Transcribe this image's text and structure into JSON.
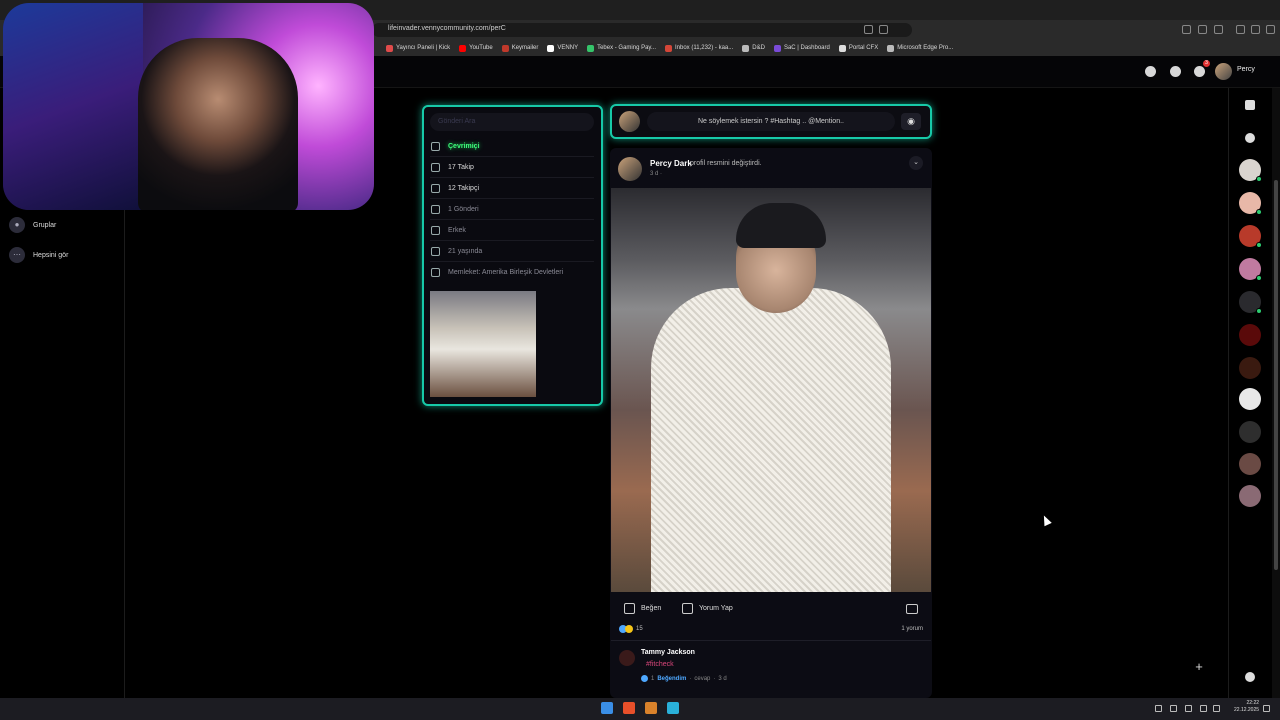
{
  "browser": {
    "url": "lifeinvader.vennycommunity.com/perC",
    "bookmarks": [
      {
        "label": "Yayıncı Paneli | Kick",
        "color": "#e04b4b"
      },
      {
        "label": "YouTube",
        "color": "#ff0000"
      },
      {
        "label": "Keymailer",
        "color": "#c0392b"
      },
      {
        "label": "VENNY",
        "color": "#ffffff"
      },
      {
        "label": "Tebex - Gaming Pay...",
        "color": "#35c46a"
      },
      {
        "label": "Inbox (11,232) - kaa...",
        "color": "#d44638"
      },
      {
        "label": "D&D",
        "color": "#bbbbbb"
      },
      {
        "label": "SaC | Dashboard",
        "color": "#7a4bd8"
      },
      {
        "label": "Portal CFX",
        "color": "#dddddd"
      },
      {
        "label": "Microsoft Edge Pro...",
        "color": "#bbbbbb"
      }
    ]
  },
  "header": {
    "user_name": "Percy",
    "notification_count": "3"
  },
  "left_nav": {
    "items": [
      {
        "label": "Gruplar",
        "icon": "groups-icon"
      },
      {
        "label": "Hepsini gör",
        "icon": "more-icon"
      }
    ]
  },
  "profile": {
    "search_placeholder": "Gönderi Ara",
    "status": "Çevrimiçi",
    "following": "17 Takip",
    "followers": "12 Takipçi",
    "posts": "1 Gönderi",
    "gender": "Erkek",
    "age": "21 yaşında",
    "hometown": "Memleket: Amerika Birleşik Devletleri"
  },
  "composer": {
    "placeholder": "Ne söylemek istersin ? #Hashtag .. @Mention..",
    "camera_icon": "camera-icon"
  },
  "post": {
    "author": "Percy Dark",
    "action": "profil resmini değiştirdi.",
    "time": "3 d ·",
    "like_label": "Beğen",
    "comment_label": "Yorum Yap",
    "reaction_count": "15",
    "comment_count": "1 yorum",
    "comment": {
      "author": "Tammy Jackson",
      "text": "#fitcheck",
      "like_count": "1",
      "liked_label": "Beğendim",
      "reply_label": "cevap",
      "time": "3 d"
    }
  },
  "taskbar": {
    "time": "22:22",
    "date": "22.12.2025"
  },
  "colors": {
    "accent": "#17c9a8",
    "online": "#3dff7a",
    "hashtag": "#d9467a",
    "link": "#4ea8ff"
  }
}
